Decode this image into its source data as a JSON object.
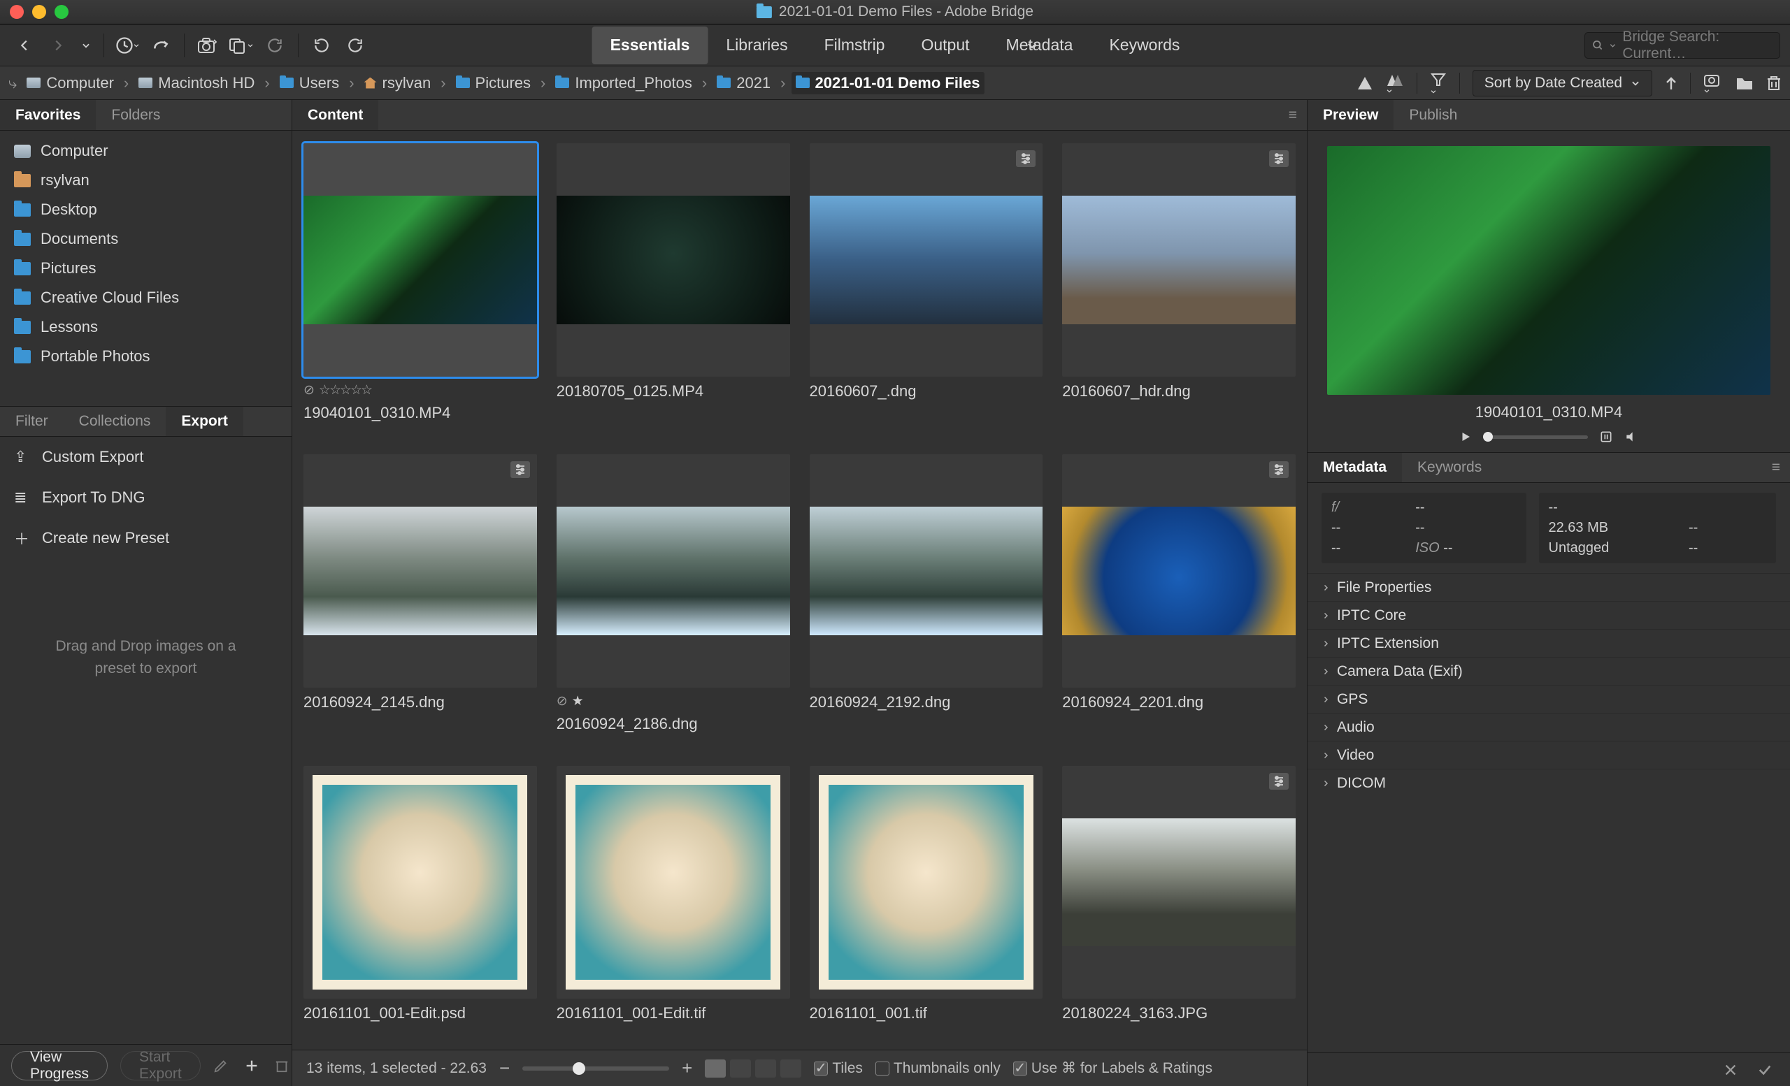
{
  "title": "2021-01-01 Demo Files - Adobe Bridge",
  "workspaces": [
    "Essentials",
    "Libraries",
    "Filmstrip",
    "Output",
    "Metadata",
    "Keywords"
  ],
  "workspace_active": 0,
  "search_placeholder": "Bridge Search: Current…",
  "breadcrumbs": [
    "Computer",
    "Macintosh HD",
    "Users",
    "rsylvan",
    "Pictures",
    "Imported_Photos",
    "2021",
    "2021-01-01 Demo Files"
  ],
  "sort_label": "Sort by Date Created",
  "panels": {
    "favorites_tab": "Favorites",
    "folders_tab": "Folders",
    "content_tab": "Content",
    "preview_tab": "Preview",
    "publish_tab": "Publish",
    "filter_tab": "Filter",
    "collections_tab": "Collections",
    "export_tab": "Export",
    "metadata_tab": "Metadata",
    "keywords_tab": "Keywords"
  },
  "favorites": [
    {
      "label": "Computer",
      "icon": "mon"
    },
    {
      "label": "rsylvan",
      "icon": "home"
    },
    {
      "label": "Desktop",
      "icon": "folder"
    },
    {
      "label": "Documents",
      "icon": "folder"
    },
    {
      "label": "Pictures",
      "icon": "folder"
    },
    {
      "label": "Creative Cloud Files",
      "icon": "folder"
    },
    {
      "label": "Lessons",
      "icon": "folder"
    },
    {
      "label": "Portable Photos",
      "icon": "folder"
    }
  ],
  "export_presets": [
    {
      "label": "Custom Export",
      "glyph": "export"
    },
    {
      "label": "Export To DNG",
      "glyph": "list"
    },
    {
      "label": "Create new Preset",
      "glyph": "plus"
    }
  ],
  "drop_hint": "Drag and Drop images on a preset to export",
  "view_progress": "View Progress",
  "start_export": "Start Export",
  "thumbnails": [
    {
      "name": "19040101_0310.MP4",
      "selected": true,
      "stars": "0",
      "badge": false,
      "reject": true,
      "gradient": "linear-gradient(135deg,#1a6b2a 0%,#2f9a3f 35%,#0e2a14 55%,#10324a 100%)"
    },
    {
      "name": "20180705_0125.MP4",
      "selected": false,
      "badge": false,
      "gradient": "radial-gradient(circle at 50% 45%,#1f3a30 0%,#0d1a15 70%,#070c0a 100%)"
    },
    {
      "name": "20160607_.dng",
      "selected": false,
      "badge": true,
      "gradient": "linear-gradient(#6aa7d6 0%,#3a5f86 50%,#22303f 100%)"
    },
    {
      "name": "20160607_hdr.dng",
      "selected": false,
      "badge": true,
      "gradient": "linear-gradient(#9fbbd8 0%,#7f95ad 45%,#6a5b4a 80%)"
    },
    {
      "name": "20160924_2145.dng",
      "selected": false,
      "badge": true,
      "gradient": "linear-gradient(#cfd5d8 0%,#7e8a82 40%,#4a5a4e 70%,#d8e4ec 100%)"
    },
    {
      "name": "20160924_2186.dng",
      "selected": false,
      "badge": false,
      "reject": true,
      "onestar": true,
      "gradient": "linear-gradient(#b7c8cd 0%,#5f726a 40%,#2a3a36 70%,#d7efff 100%)"
    },
    {
      "name": "20160924_2192.dng",
      "selected": false,
      "badge": false,
      "gradient": "linear-gradient(#bfcfd6 0%,#6b7f78 40%,#2f403a 70%,#cfe9ff 100%)"
    },
    {
      "name": "20160924_2201.dng",
      "selected": false,
      "badge": true,
      "gradient": "radial-gradient(circle at 50% 55%,#1a5fb8 0%,#0e3c82 55%,#b38a2e 80%,#d8a83f 100%)"
    },
    {
      "name": "20161101_001-Edit.psd",
      "selected": false,
      "badge": false,
      "gradient": "radial-gradient(circle at 50% 45%,#f5e6cc 0%,#d8c9a8 40%,#3e9da8 80%)"
    },
    {
      "name": "20161101_001-Edit.tif",
      "selected": false,
      "badge": false,
      "gradient": "radial-gradient(circle at 50% 45%,#f5e6cc 0%,#d8c9a8 40%,#3e9da8 80%)"
    },
    {
      "name": "20161101_001.tif",
      "selected": false,
      "badge": false,
      "gradient": "radial-gradient(circle at 50% 45%,#f5e6cc 0%,#d8c9a8 40%,#3e9da8 80%)"
    },
    {
      "name": "20180224_3163.JPG",
      "selected": false,
      "badge": true,
      "gradient": "linear-gradient(#dce2e2 0%,#8a8f84 40%,#3c3f38 75%)"
    }
  ],
  "status_bar": {
    "count_text": "13 items, 1 selected - 22.63",
    "tiles_label": "Tiles",
    "thumbs_only_label": "Thumbnails only",
    "cmd_label": "Use ⌘ for Labels & Ratings"
  },
  "preview": {
    "filename": "19040101_0310.MP4",
    "gradient": "linear-gradient(135deg,#1a6b2a 0%,#2f9a3f 35%,#0e2a14 55%,#10324a 100%)"
  },
  "metadata_summary": {
    "f_label": "f/",
    "f_val": "--",
    "shutter": "--",
    "ev": "--",
    "awb": "--",
    "iso_label": "ISO",
    "iso": "--",
    "size": "22.63 MB",
    "dim": "--",
    "label": "Untagged",
    "label2": "--",
    "dash": "--"
  },
  "metadata_sections": [
    "File Properties",
    "IPTC Core",
    "IPTC Extension",
    "Camera Data (Exif)",
    "GPS",
    "Audio",
    "Video",
    "DICOM"
  ]
}
